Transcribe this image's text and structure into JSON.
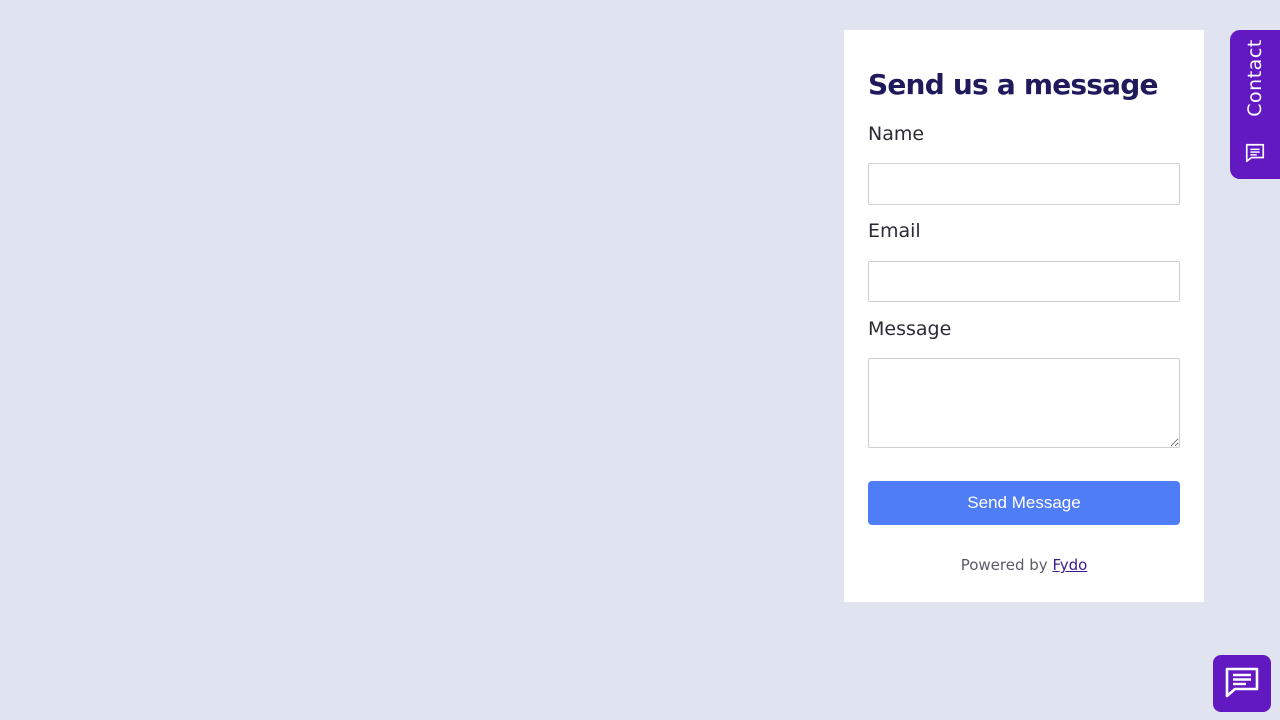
{
  "form": {
    "title": "Send us a message",
    "name_label": "Name",
    "name_value": "",
    "email_label": "Email",
    "email_value": "",
    "message_label": "Message",
    "message_value": "",
    "submit_label": "Send Message",
    "powered_prefix": "Powered by ",
    "powered_link": "Fydo"
  },
  "contact_tab": {
    "label": "Contact",
    "icon": "chat-icon"
  },
  "chat_launcher": {
    "icon": "chat-icon"
  },
  "colors": {
    "background": "#e0e4f0",
    "title": "#1e1a5c",
    "button": "#4f7cf7",
    "accent_purple": "#6219c2",
    "link": "#3b1b8f"
  }
}
